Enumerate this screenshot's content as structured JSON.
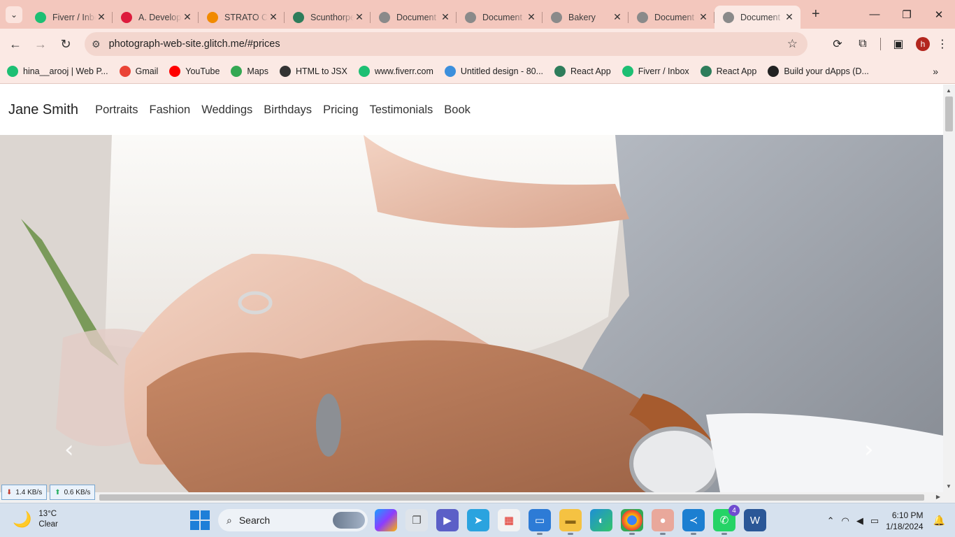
{
  "browser": {
    "tabs": [
      {
        "title": "Fiverr / Inbox",
        "icon": "fiverr-icon",
        "color": "#1dbf73"
      },
      {
        "title": "A. Developer",
        "icon": "angular-icon",
        "color": "#dd1b3c"
      },
      {
        "title": "STRATO Customer",
        "icon": "strato-icon",
        "color": "#f18a00"
      },
      {
        "title": "Scunthorpe",
        "icon": "react-app-icon",
        "color": "#2e7d5b"
      },
      {
        "title": "Document",
        "icon": "globe-icon",
        "color": "#8a8a8a"
      },
      {
        "title": "Document",
        "icon": "globe-icon",
        "color": "#8a8a8a"
      },
      {
        "title": "Bakery",
        "icon": "globe-icon",
        "color": "#8a8a8a"
      },
      {
        "title": "Document",
        "icon": "globe-icon",
        "color": "#8a8a8a"
      },
      {
        "title": "Document",
        "icon": "globe-icon",
        "color": "#8a8a8a",
        "active": true
      }
    ],
    "url": "photograph-web-site.glitch.me/#prices",
    "profile_initial": "h",
    "bookmarks": [
      {
        "label": "hina__arooj | Web P...",
        "icon": "fiverr-icon",
        "color": "#1dbf73"
      },
      {
        "label": "Gmail",
        "icon": "gmail-icon",
        "color": "#ea4335"
      },
      {
        "label": "YouTube",
        "icon": "youtube-icon",
        "color": "#ff0000"
      },
      {
        "label": "Maps",
        "icon": "maps-icon",
        "color": "#34a853"
      },
      {
        "label": "HTML to JSX",
        "icon": "globe-icon",
        "color": "#333333"
      },
      {
        "label": "www.fiverr.com",
        "icon": "fiverr-icon",
        "color": "#1dbf73"
      },
      {
        "label": "Untitled design - 80...",
        "icon": "canva-icon",
        "color": "#3c8fdc"
      },
      {
        "label": "React App",
        "icon": "react-app-icon",
        "color": "#2e7d5b"
      },
      {
        "label": "Fiverr / Inbox",
        "icon": "fiverr-icon",
        "color": "#1dbf73"
      },
      {
        "label": "React App",
        "icon": "react-app-icon",
        "color": "#2e7d5b"
      },
      {
        "label": "Build your dApps (D...",
        "icon": "vercel-icon",
        "color": "#222222"
      }
    ]
  },
  "site": {
    "brand": "Jane Smith",
    "nav": [
      "Portraits",
      "Fashion",
      "Weddings",
      "Birthdays",
      "Pricing",
      "Testimonials",
      "Book"
    ],
    "hero_alt": "Wedding hands with rings"
  },
  "netspeed": {
    "down": "1.4 KB/s",
    "up": "0.6 KB/s"
  },
  "taskbar": {
    "weather_temp": "13°C",
    "weather_desc": "Clear",
    "search_label": "Search",
    "whatsapp_badge": "4",
    "time": "6:10 PM",
    "date": "1/18/2024"
  }
}
